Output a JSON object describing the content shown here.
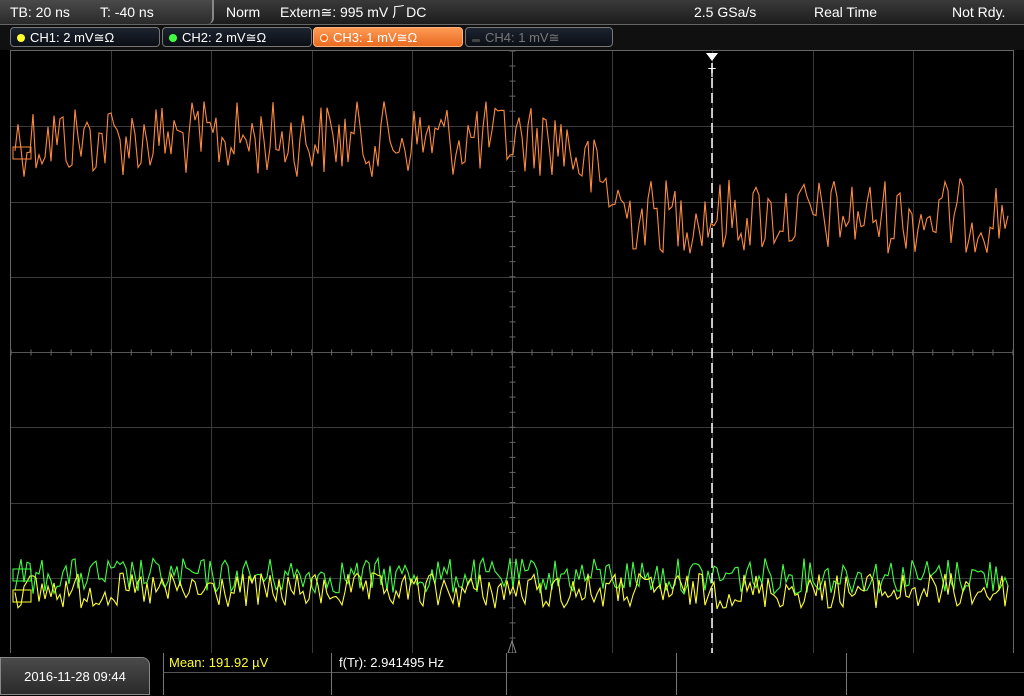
{
  "topbar": {
    "timebase": "TB: 20 ns",
    "trigger_time": "T: -40 ns",
    "mode": "Norm",
    "trigger_source": "Extern≅: 995 mV ⺁DC",
    "sample_rate": "2.5 GSa/s",
    "acq_mode": "Real Time",
    "status": "Not Rdy."
  },
  "channels": [
    {
      "label": "CH1: 2 mV≅Ω",
      "color": "#ffff30",
      "state": "on"
    },
    {
      "label": "CH2: 2 mV≅Ω",
      "color": "#40ff40",
      "state": "on"
    },
    {
      "label": "CH3: 1 mV≅Ω",
      "color": "#ff8a3c",
      "state": "active"
    },
    {
      "label": "CH4: 1 mV≅",
      "color": "#777777",
      "state": "off"
    }
  ],
  "trigger_marker": "T",
  "bottom": {
    "datetime": "2016-11-28 09:44",
    "mean": "Mean: 191.92 µV",
    "freq": "f(Tr): 2.941495 Hz"
  },
  "colors": {
    "ch1": "#ffff30",
    "ch2": "#40ff40",
    "ch3": "#ff8a3c",
    "grid": "#3a3a3a"
  }
}
